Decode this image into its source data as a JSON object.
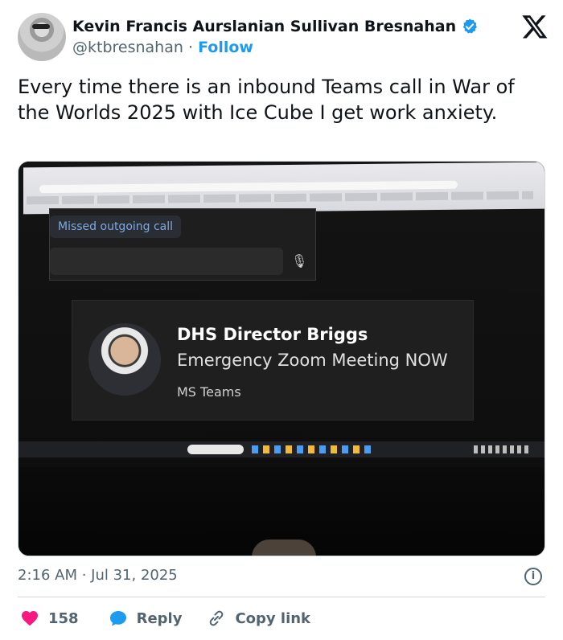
{
  "author": {
    "name": "Kevin Francis Aurslanian Sullivan Bresnahan",
    "handle": "@ktbresnahan",
    "separator": "·",
    "follow_label": "Follow"
  },
  "tweet": {
    "text": "Every time there is an inbound Teams call in War of the Worlds 2025 with Ice Cube I get work anxiety."
  },
  "media": {
    "chat": {
      "missed_call_label": "Missed outgoing call"
    },
    "notification": {
      "caller_name": "DHS Director Briggs",
      "message": "Emergency Zoom Meeting NOW",
      "app_name": "MS Teams"
    }
  },
  "meta": {
    "timestamp": "2:16 AM · Jul 31, 2025"
  },
  "actions": {
    "like_count": "158",
    "reply_label": "Reply",
    "copy_link_label": "Copy link"
  },
  "colors": {
    "accent": "#1d9bf0",
    "like": "#f91880",
    "text": "#0f1419",
    "secondary": "#536471"
  },
  "icons": [
    "verified-badge-icon",
    "x-logo-icon",
    "info-icon",
    "heart-icon",
    "reply-icon",
    "link-icon",
    "microphone-icon"
  ]
}
